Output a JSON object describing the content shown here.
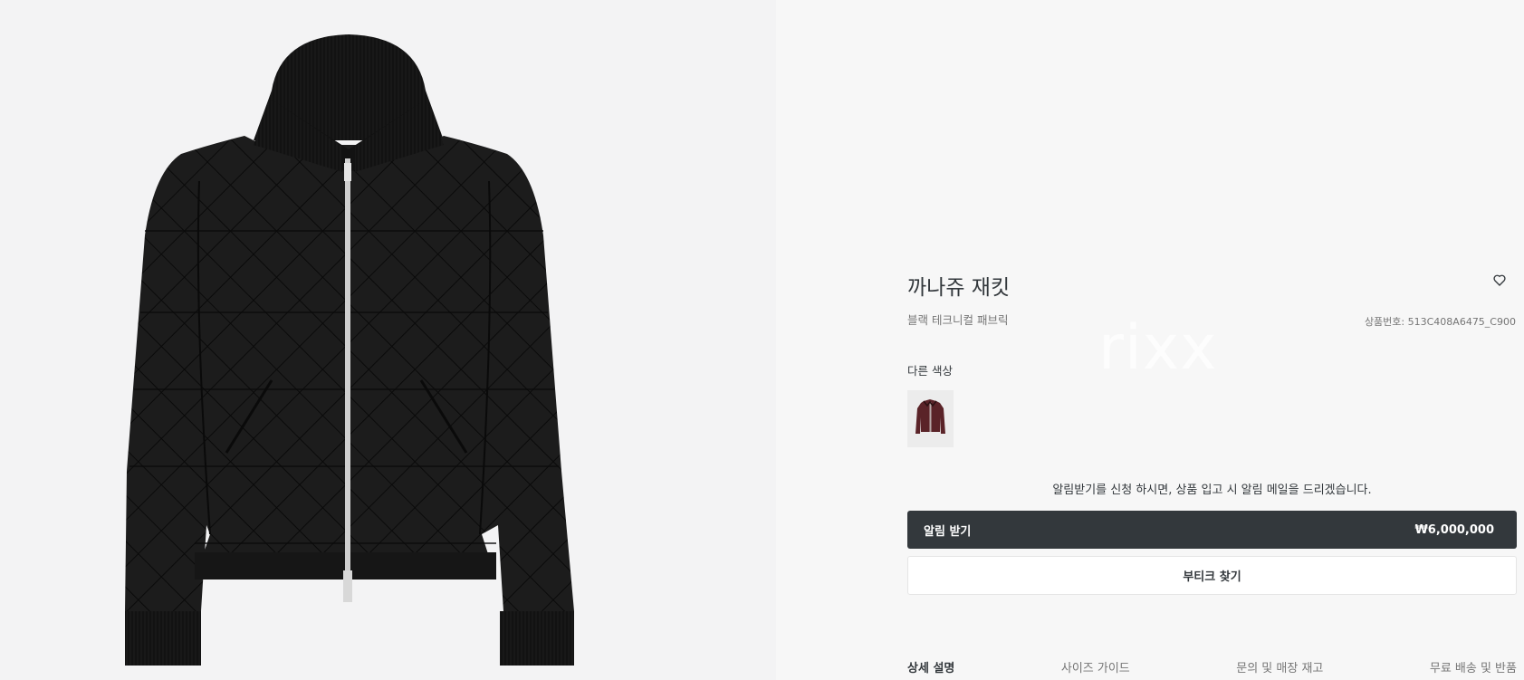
{
  "product": {
    "title": "까나쥬 재킷",
    "subtitle": "블랙 테크니컬 패브릭",
    "reference": "상품번호: 513C408A6475_C900",
    "price": "₩6,000,000"
  },
  "image": {
    "icon": "jacket-icon",
    "alt_color_icon": "jacket-icon"
  },
  "watermark": "rixx",
  "colors": {
    "label": "다른 색상",
    "options": [
      {
        "name": "burgundy",
        "swatch_color": "#5a2328"
      }
    ]
  },
  "notify": {
    "message": "알림받기를 신청 하시면, 상품 입고 시 알림 메일을 드리겠습니다.",
    "button_label": "알림 받기"
  },
  "boutique": {
    "button_label": "부티크 찾기"
  },
  "tabs": [
    {
      "label": "상세 설명",
      "active": true
    },
    {
      "label": "사이즈 가이드",
      "active": false
    },
    {
      "label": "문의 및 매장 재고",
      "active": false
    },
    {
      "label": "무료 배송 및 반품",
      "active": false
    }
  ],
  "colors_theme": {
    "dark": "#33383c",
    "muted": "#757575",
    "image_bg": "#f3f3f4",
    "panel_bg": "#f7f7f7"
  }
}
